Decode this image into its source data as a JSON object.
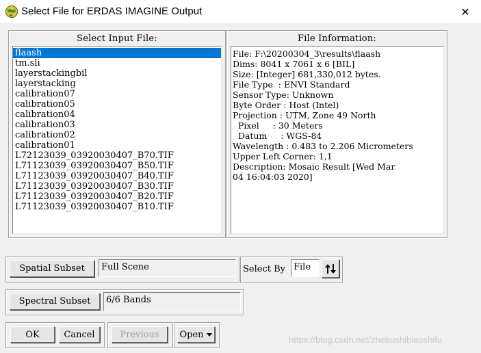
{
  "window": {
    "title": "Select File for ERDAS IMAGINE Output",
    "icon": "erdas-globe-icon",
    "close_symbol": "✕"
  },
  "input_panel": {
    "label": "Select Input File:",
    "items": [
      "flaash",
      "tm.sli",
      "layerstackingbil",
      "layerstacking",
      "calibration07",
      "calibration05",
      "calibration04",
      "calibration03",
      "calibration02",
      "calibration01",
      "L72123039_03920030407_B70.TIF",
      "L71123039_03920030407_B50.TIF",
      "L71123039_03920030407_B40.TIF",
      "L71123039_03920030407_B30.TIF",
      "L71123039_03920030407_B20.TIF",
      "L71123039_03920030407_B10.TIF"
    ],
    "selected_index": 0
  },
  "info_panel": {
    "label": "File Information:",
    "lines": [
      "File: F:\\20200304_3\\results\\flaash",
      "Dims: 8041 x 7061 x 6 [BIL]",
      "Size: [Integer] 681,330,012 bytes.",
      "File Type  : ENVI Standard",
      "Sensor Type: Unknown",
      "Byte Order : Host (Intel)",
      "Projection : UTM, Zone 49 North",
      "  Pixel     : 30 Meters",
      "  Datum     : WGS-84",
      "Wavelength : 0.483 to 2.206 Micrometers",
      "Upper Left Corner: 1,1",
      "Description: Mosaic Result [Wed Mar",
      "04 16:04:03 2020]"
    ]
  },
  "spatial_subset": {
    "button_label": "Spatial Subset",
    "value": "Full Scene"
  },
  "select_by": {
    "label": "Select By",
    "value": "File",
    "toggle_icon": "sort-arrows-icon"
  },
  "spectral_subset": {
    "button_label": "Spectral Subset",
    "value": "6/6 Bands"
  },
  "buttons": {
    "ok": "OK",
    "cancel": "Cancel",
    "previous": "Previous",
    "open": "Open"
  },
  "watermark": "https://blog.csdn.net/zhebushibiaoshifu",
  "colors": {
    "selection": "#0078d7",
    "background": "#f0f0f0"
  }
}
